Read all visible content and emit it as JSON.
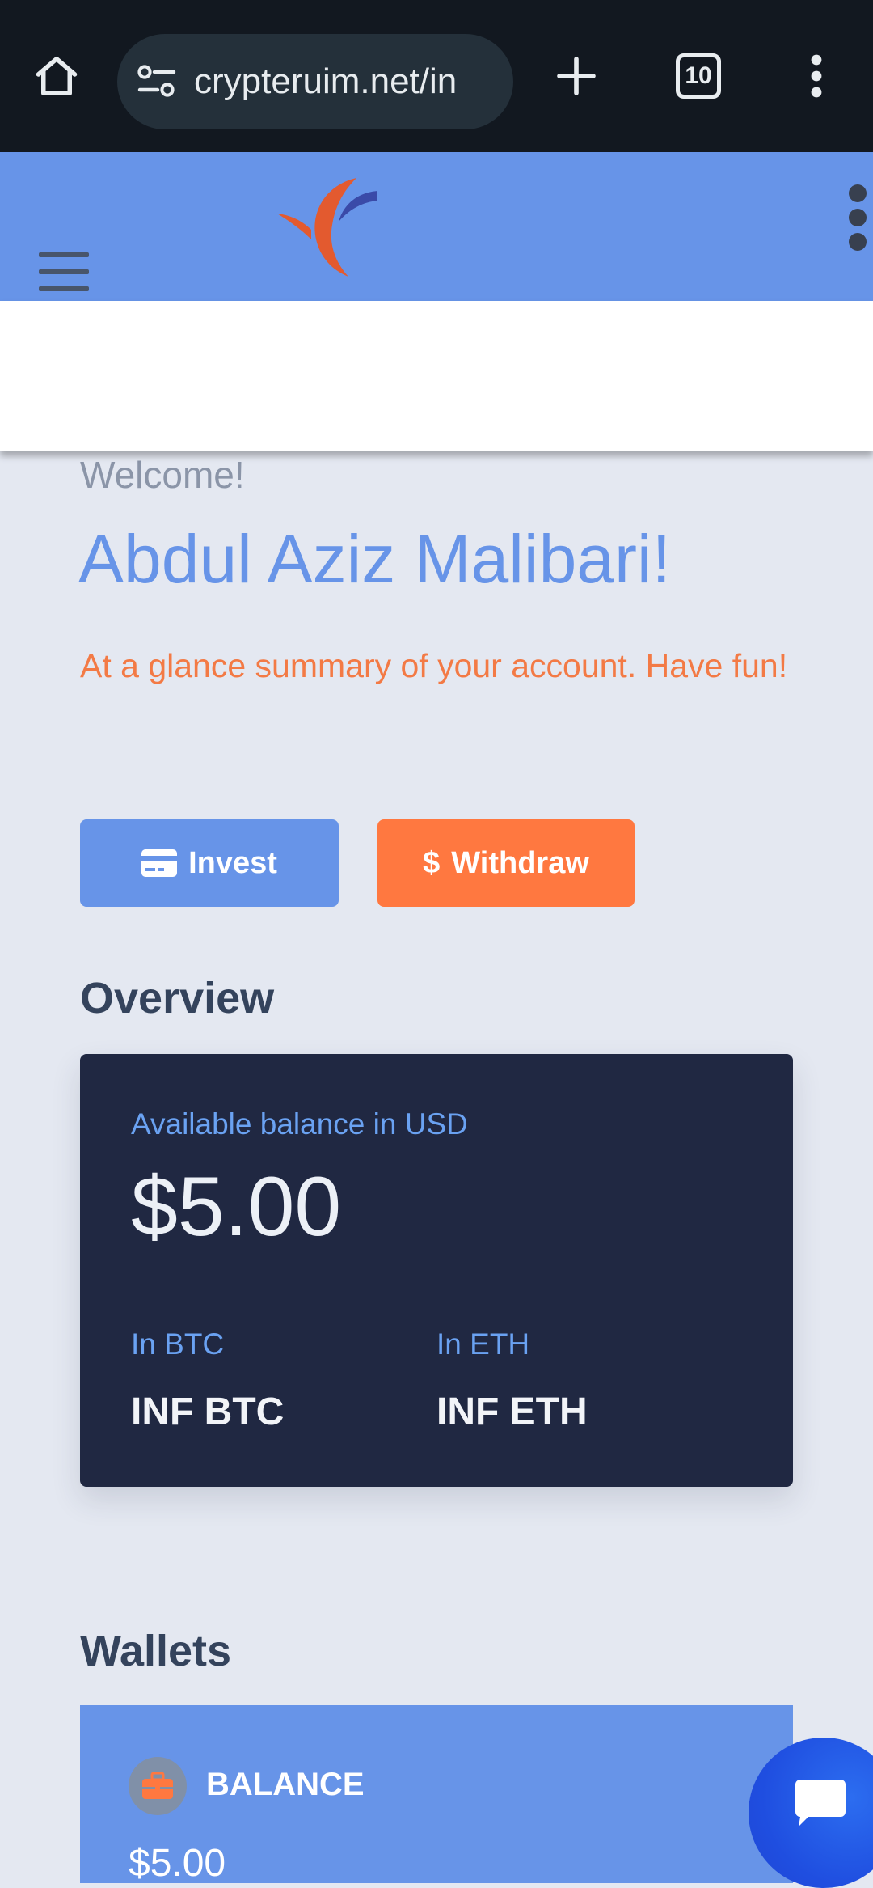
{
  "browser": {
    "url": "crypteruim.net/in",
    "tab_count": "10"
  },
  "main": {
    "welcome": "Welcome!",
    "user_name": "Abdul Aziz Malibari!",
    "summary": "At a glance summary of your account. Have fun!",
    "invest_label": "Invest",
    "withdraw_label": "Withdraw",
    "withdraw_symbol": "$"
  },
  "overview": {
    "title": "Overview",
    "balance_label": "Available balance in USD",
    "balance_value": "$5.00",
    "btc_label": "In BTC",
    "btc_value": "INF BTC",
    "eth_label": "In ETH",
    "eth_value": "INF ETH"
  },
  "wallets": {
    "title": "Wallets",
    "items": [
      {
        "label": "BALANCE",
        "amount": "$5.00",
        "icon": "briefcase-icon"
      }
    ]
  },
  "colors": {
    "header_bg": "#6794e8",
    "accent_blue": "#6794e8",
    "accent_orange": "#ff7840",
    "card_dark": "#202842",
    "page_bg": "#e4e8f1"
  }
}
